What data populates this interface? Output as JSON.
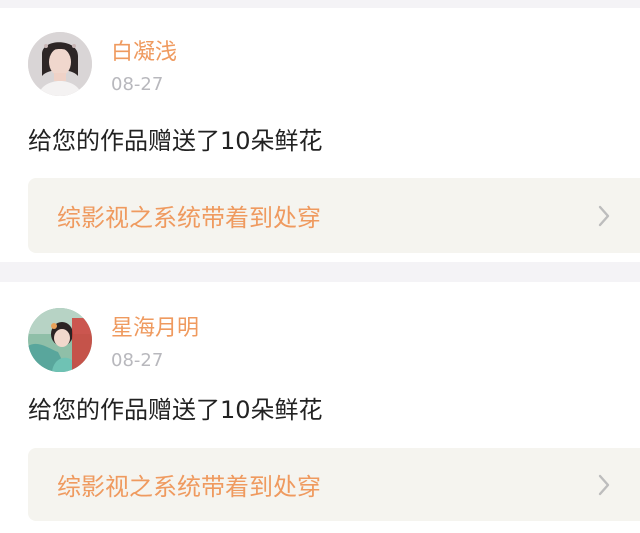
{
  "notifications": [
    {
      "username": "白凝浅",
      "date": "08-27",
      "message": "给您的作品赠送了10朵鲜花",
      "work_title": "综影视之系统带着到处穿"
    },
    {
      "username": "星海月明",
      "date": "08-27",
      "message": "给您的作品赠送了10朵鲜花",
      "work_title": "综影视之系统带着到处穿"
    }
  ],
  "colors": {
    "accent": "#ef9a5f",
    "date": "#b8b8bd",
    "text": "#222222",
    "panel": "#f5f4ef",
    "background": "#f4f3f6"
  },
  "icons": {
    "chevron": "chevron-right-icon",
    "avatar": "avatar"
  }
}
